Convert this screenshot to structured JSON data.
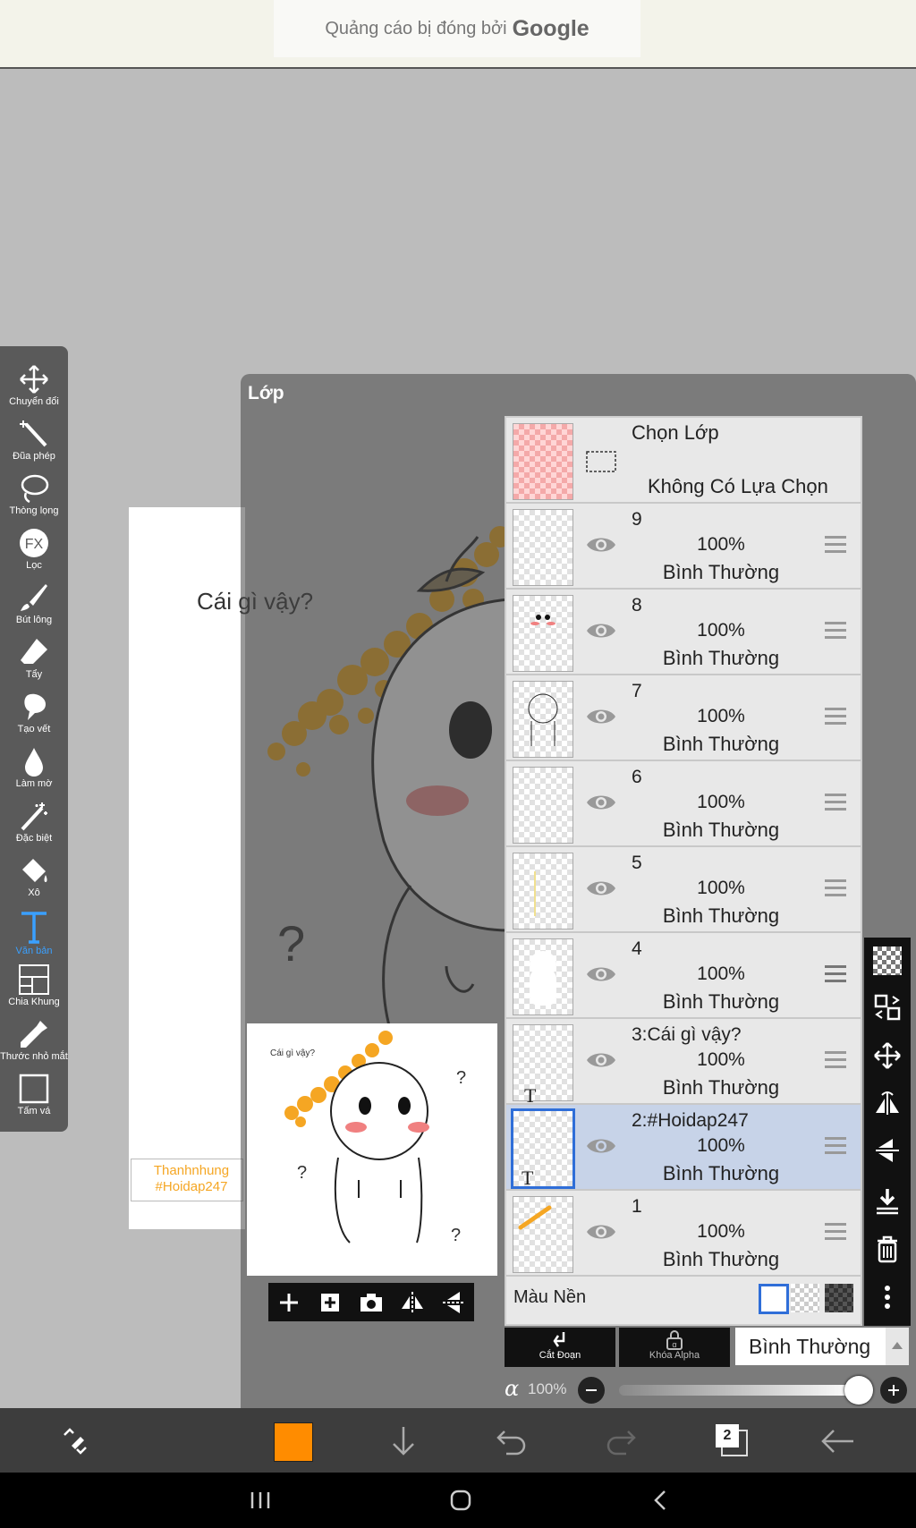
{
  "ad": {
    "prefix": "Quảng cáo bị đóng bởi",
    "brand": "Google"
  },
  "tools": [
    {
      "label": "Chuyển đổi",
      "icon": "move-icon"
    },
    {
      "label": "Đũa phép",
      "icon": "magic-wand-icon"
    },
    {
      "label": "Thòng lọng",
      "icon": "lasso-icon"
    },
    {
      "label": "Lọc",
      "icon": "fx-filter-icon"
    },
    {
      "label": "Bút lông",
      "icon": "brush-icon"
    },
    {
      "label": "Tẩy",
      "icon": "eraser-icon"
    },
    {
      "label": "Tạo vết",
      "icon": "smudge-icon"
    },
    {
      "label": "Làm mờ",
      "icon": "blur-drop-icon"
    },
    {
      "label": "Đặc biệt",
      "icon": "special-brush-icon"
    },
    {
      "label": "Xô",
      "icon": "bucket-icon"
    },
    {
      "label": "Văn bản",
      "icon": "text-icon",
      "active": true
    },
    {
      "label": "Chia Khung",
      "icon": "frame-divider-icon"
    },
    {
      "label": "Thước nhỏ mắt",
      "icon": "eyedropper-icon"
    },
    {
      "label": "Tấm vá",
      "icon": "canvas-icon"
    }
  ],
  "panel_title": "Lớp",
  "canvas": {
    "text": "Cái gì vậy?",
    "question_mark": "?",
    "signature_line1": "Thanhnhung",
    "signature_line2": "#Hoidap247"
  },
  "thumbnail": {
    "text": "Cái gì vậy?",
    "q": "?"
  },
  "select_layer": {
    "title": "Chọn Lớp",
    "status": "Không Có Lựa Chọn"
  },
  "layers": [
    {
      "name": "9",
      "opacity": "100%",
      "mode": "Bình Thường"
    },
    {
      "name": "8",
      "opacity": "100%",
      "mode": "Bình Thường"
    },
    {
      "name": "7",
      "opacity": "100%",
      "mode": "Bình Thường"
    },
    {
      "name": "6",
      "opacity": "100%",
      "mode": "Bình Thường"
    },
    {
      "name": "5",
      "opacity": "100%",
      "mode": "Bình Thường"
    },
    {
      "name": "4",
      "opacity": "100%",
      "mode": "Bình Thường"
    },
    {
      "name": "3:Cái gì vậy?",
      "opacity": "100%",
      "mode": "Bình Thường",
      "text_layer": true
    },
    {
      "name": "2:#Hoidap247",
      "opacity": "100%",
      "mode": "Bình Thường",
      "text_layer": true,
      "selected": true
    },
    {
      "name": "1",
      "opacity": "100%",
      "mode": "Bình Thường"
    }
  ],
  "background_label": "Màu Nền",
  "clip_label": "Cắt Đoạn",
  "alpha_lock_label": "Khóa Alpha",
  "blend_mode": "Bình Thường",
  "alpha": {
    "symbol": "α",
    "value": "100%",
    "fraction": 1.0
  },
  "layer_count": "2",
  "colors": {
    "primary": "#ff8c00",
    "selected_row": "#c7d3e8",
    "active_tool": "#3aa0ff"
  }
}
